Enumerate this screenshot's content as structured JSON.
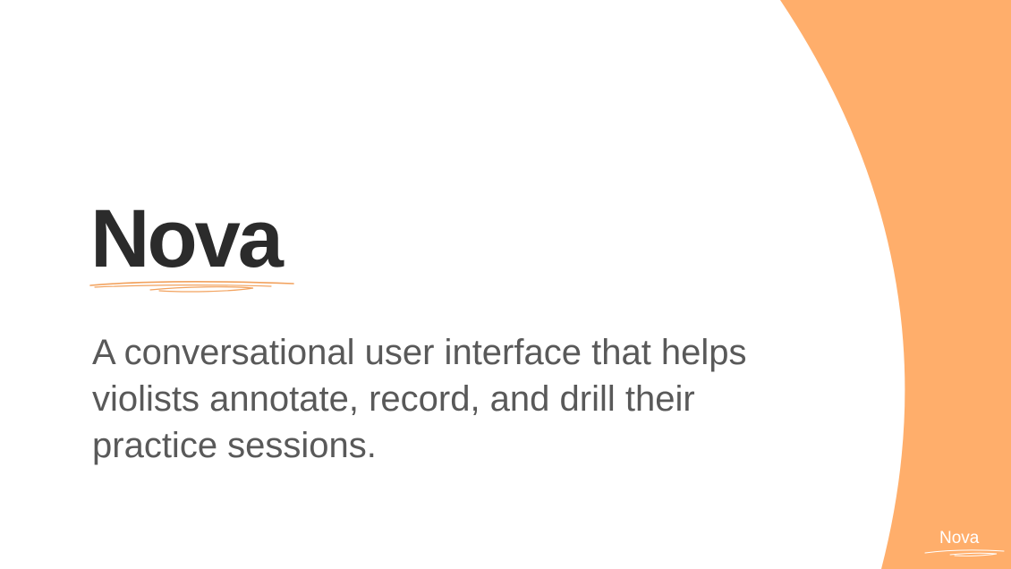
{
  "slide": {
    "title": "Nova",
    "subtitle": "A conversational user interface that helps violists annotate, record, and drill their practice sessions.",
    "footer_logo_text": "Nova"
  },
  "colors": {
    "background": "#ffffff",
    "accent": "#ffae6b",
    "title_text": "#2b2b2b",
    "body_text": "#595959",
    "underline_stroke": "#f2a25e",
    "footer_logo_text": "#ffffff"
  },
  "decorations": {
    "background_shape": "orange-arc",
    "title_underline": "hand-drawn-underline",
    "footer_logo_underline": "hand-drawn-underline"
  }
}
